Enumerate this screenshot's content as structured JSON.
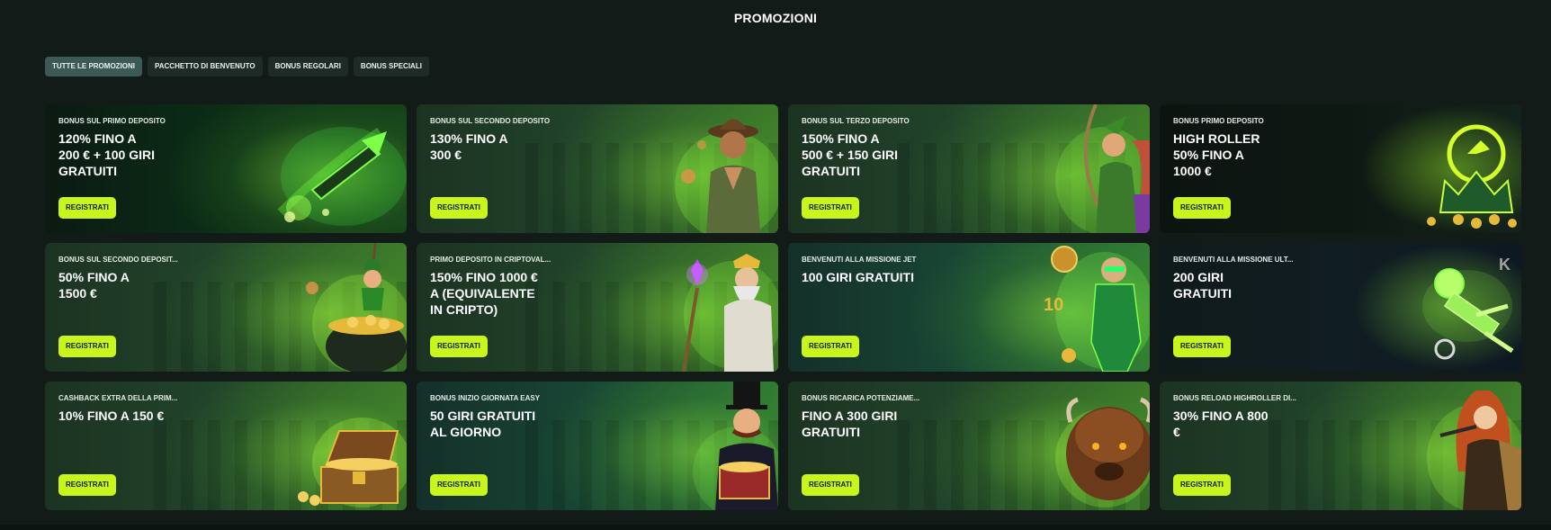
{
  "page": {
    "title": "PROMOZIONI"
  },
  "tabs": [
    {
      "label": "TUTTE LE PROMOZIONI",
      "active": true
    },
    {
      "label": "PACCHETTO DI BENVENUTO",
      "active": false
    },
    {
      "label": "BONUS REGOLARI",
      "active": false
    },
    {
      "label": "BONUS SPECIALI",
      "active": false
    }
  ],
  "cards": [
    {
      "label": "BONUS SUL PRIMO DEPOSITO",
      "title": "120% FINO A\n 200 € + 100 GIRI\nGRATUITI",
      "button": "REGISTRATI",
      "art": "rocket-icon"
    },
    {
      "label": "BONUS SUL SECONDO DEPOSITO",
      "title": "130% FINO A\n 300 €",
      "button": "REGISTRATI",
      "art": "explorer-icon"
    },
    {
      "label": "BONUS SUL TERZO DEPOSITO",
      "title": "150% FINO A\n 500 € + 150 GIRI\nGRATUITI",
      "button": "REGISTRATI",
      "art": "archer-icon"
    },
    {
      "label": "BONUS PRIMO DEPOSITO",
      "title": "HIGH ROLLER\n50% FINO A\n 1000 €",
      "button": "REGISTRATI",
      "art": "crown-icon"
    },
    {
      "label": "BONUS SUL SECONDO DEPOSIT...",
      "title": "50% FINO A\n 1500 €",
      "button": "REGISTRATI",
      "art": "leprechaun-icon"
    },
    {
      "label": "PRIMO DEPOSITO IN CRIPTOVAL...",
      "title": "150% FINO 1000 €\n A (EQUIVALENTE\nIN CRIPTO)",
      "button": "REGISTRATI",
      "art": "wizard-icon"
    },
    {
      "label": "BENVENUTI ALLA MISSIONE JET",
      "title": "100 GIRI GRATUITI",
      "button": "REGISTRATI",
      "art": "hero-icon"
    },
    {
      "label": "BENVENUTI ALLA MISSIONE ULT...",
      "title": "200 GIRI\nGRATUITI",
      "button": "REGISTRATI",
      "art": "astronaut-icon"
    },
    {
      "label": "CASHBACK EXTRA DELLA PRIM...",
      "title": "10% FINO A 150 €",
      "button": "REGISTRATI",
      "art": "treasure-chest-icon"
    },
    {
      "label": "BONUS INIZIO GIORNATA EASY",
      "title": "50 GIRI GRATUITI\nAL GIORNO",
      "button": "REGISTRATI",
      "art": "tycoon-icon"
    },
    {
      "label": "BONUS RICARICA POTENZIAME...",
      "title": "FINO A 300 GIRI\nGRATUITI",
      "button": "REGISTRATI",
      "art": "bison-icon"
    },
    {
      "label": "BONUS RELOAD HIGHROLLER DI...",
      "title": "30% FINO A 800\n€",
      "button": "REGISTRATI",
      "art": "heroine-icon"
    }
  ],
  "colors": {
    "accent": "#c8f51c",
    "background": "#121b18",
    "tab": "#1f2b27",
    "tab_active": "#3b5a55"
  }
}
